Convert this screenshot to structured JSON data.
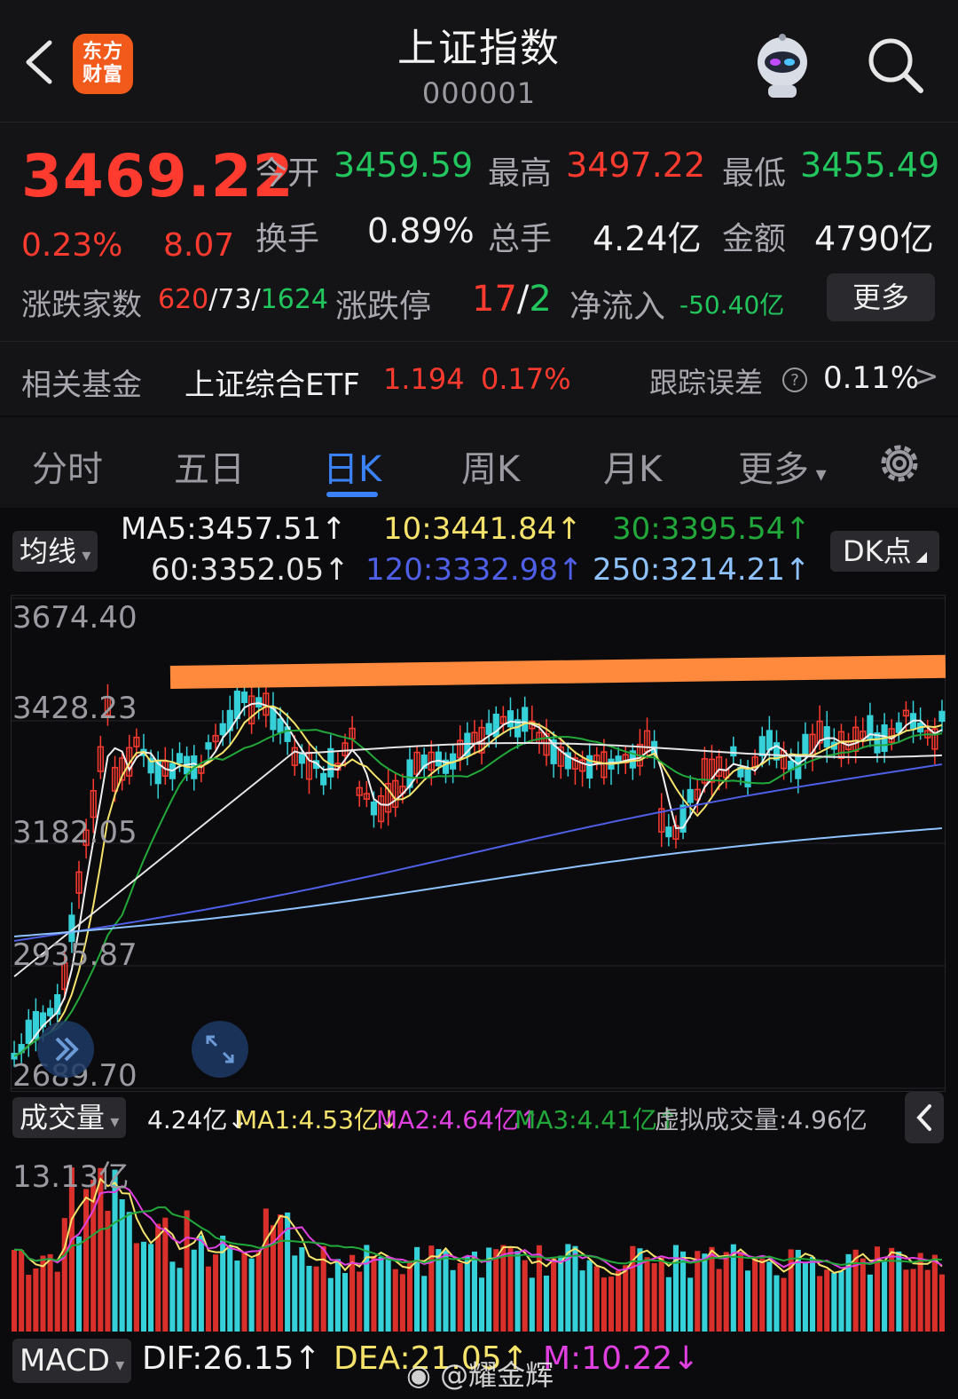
{
  "header": {
    "logo_text": "东方财富",
    "title": "上证指数",
    "code": "000001"
  },
  "quote": {
    "price": "3469.22",
    "change_pct": "0.23%",
    "change": "8.07",
    "open_label": "今开",
    "open": "3459.59",
    "high_label": "最高",
    "high": "3497.22",
    "low_label": "最低",
    "low": "3455.49",
    "turnover_label": "换手",
    "turnover": "0.89%",
    "volume_label": "总手",
    "volume": "4.24亿",
    "amount_label": "金额",
    "amount": "4790亿",
    "breadth_label": "涨跌家数",
    "up_count": "620",
    "flat_count": "73",
    "down_count": "1624",
    "limit_label": "涨跌停",
    "limit_up": "17",
    "limit_down": "2",
    "netflow_label": "净流入",
    "netflow": "-50.40亿",
    "more_button": "更多",
    "fund_label": "相关基金",
    "fund_name": "上证综合ETF",
    "fund_price": "1.194",
    "fund_pct": "0.17%",
    "tracking_label": "跟踪误差",
    "tracking_value": "0.11%"
  },
  "tabs": [
    {
      "label": "分时"
    },
    {
      "label": "五日"
    },
    {
      "label": "日K"
    },
    {
      "label": "周K"
    },
    {
      "label": "月K"
    },
    {
      "label": "更多"
    }
  ],
  "active_tab": "日K",
  "ma": {
    "selector": "均线",
    "ma5": "MA5:3457.51↑",
    "ma10": "10:3441.84↑",
    "ma30": "30:3395.54↑",
    "ma60": "60:3352.05↑",
    "ma120": "120:3332.98↑",
    "ma250": "250:3214.21↑",
    "dk_button": "DK点"
  },
  "price_axis": [
    "3674.40",
    "3428.23",
    "3182.05",
    "2935.87",
    "2689.70"
  ],
  "volume": {
    "selector": "成交量",
    "vol": "4.24亿↓",
    "ma1": "MA1:4.53亿↓",
    "ma2": "MA2:4.64亿↑",
    "ma3": "MA3:4.41亿↑",
    "virtual": "虚拟成交量:4.96亿",
    "axis_max": "13.13亿"
  },
  "macd": {
    "selector": "MACD",
    "dif": "DIF:26.15↑",
    "dea": "DEA:21.05↑",
    "m": "M:10.22↓"
  },
  "watermark": "@耀金辉",
  "colors": {
    "up": "#ff3b30",
    "down": "#22c55e",
    "accent": "#3b82f6",
    "ma5": "#f0f0f0",
    "ma10": "#f5e36b",
    "ma30": "#22a83a",
    "ma60": "#e6e6e6",
    "ma120": "#4f5fe6",
    "ma250": "#8fc3ff",
    "resistance": "#ff8a3d"
  }
}
